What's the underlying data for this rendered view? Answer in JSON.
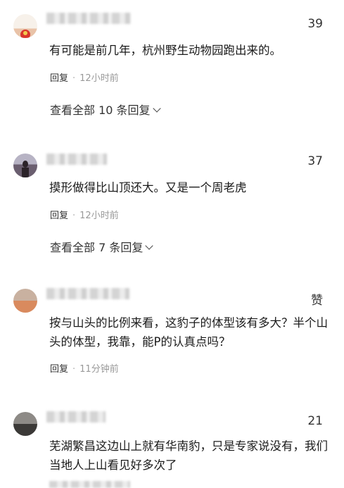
{
  "comments": [
    {
      "likes": "39",
      "text": "有可能是前几年，杭州野生动物园跑出来的。",
      "reply_label": "回复",
      "time": "12小时前",
      "more_label": "查看全部 10 条回复"
    },
    {
      "likes": "37",
      "text": "摸形做得比山顶还大。又是一个周老虎",
      "reply_label": "回复",
      "time": "12小时前",
      "more_label": "查看全部 7 条回复"
    },
    {
      "likes": "赞",
      "text": "按与山头的比例来看，这豹子的体型该有多大？半个山头的体型，我靠，能P的认真点吗？",
      "reply_label": "回复",
      "time": "11分钟前"
    },
    {
      "likes": "21",
      "text": "芜湖繁昌这边山上就有华南豹，只是专家说没有，我们当地人上山看见好多次了"
    }
  ]
}
